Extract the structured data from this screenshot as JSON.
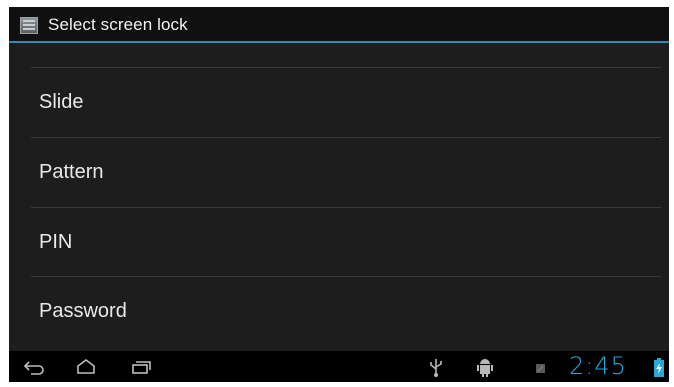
{
  "header": {
    "title": "Select screen lock",
    "icon": "settings-app-icon"
  },
  "options": [
    {
      "label": "Slide"
    },
    {
      "label": "Pattern"
    },
    {
      "label": "PIN"
    },
    {
      "label": "Password"
    }
  ],
  "system_bar": {
    "time": "2:45",
    "nav_icons": [
      "back-icon",
      "home-icon",
      "recent-apps-icon"
    ],
    "status_icons": [
      "usb-icon",
      "android-debug-icon",
      "notification-icon",
      "battery-charging-icon"
    ],
    "accent_color": "#29a9d8"
  }
}
